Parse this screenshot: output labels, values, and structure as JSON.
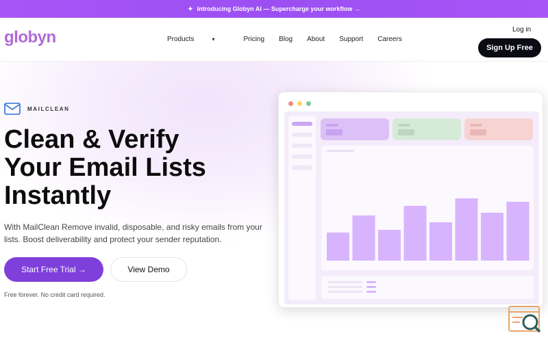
{
  "announcement": {
    "icon": "sparkle-icon",
    "text": "Introducing Globyn AI — Supercharge your workflow →"
  },
  "nav": {
    "logo": "globyn",
    "items": [
      {
        "label": "Products",
        "has_dropdown": true
      },
      {
        "label": "Pricing"
      },
      {
        "label": "Blog"
      },
      {
        "label": "About"
      },
      {
        "label": "Support"
      },
      {
        "label": "Careers"
      }
    ],
    "login": "Log in",
    "signup": "Sign Up Free"
  },
  "hero": {
    "brand": "MAILCLEAN",
    "headline_lines": [
      "Clean & Verify",
      "Your Email Lists",
      "Instantly"
    ],
    "subtitle": "With MailClean Remove invalid, disposable, and risky emails from your lists. Boost deliverability and protect your sender reputation.",
    "primary_cta": "Start Free Trial →",
    "secondary_cta": "View Demo",
    "fine_print": "Free forever. No credit card required."
  },
  "preview": {
    "window_dots": [
      "#f28b82",
      "#fdd663",
      "#81c995"
    ],
    "cards": [
      {
        "bg": "#dcc1f7",
        "accent": "#c9a3ef"
      },
      {
        "bg": "#d6ead8",
        "accent": "#bcd6bf"
      },
      {
        "bg": "#f7d3d2",
        "accent": "#e9b7b6"
      }
    ],
    "bar_color": "#d8b4fe",
    "bar_values": [
      41,
      66,
      45,
      80,
      56,
      91,
      70,
      86
    ]
  },
  "colors": {
    "accent": "#7e3fdb",
    "logo": "#b06ad8",
    "banner": "#a855f7"
  }
}
